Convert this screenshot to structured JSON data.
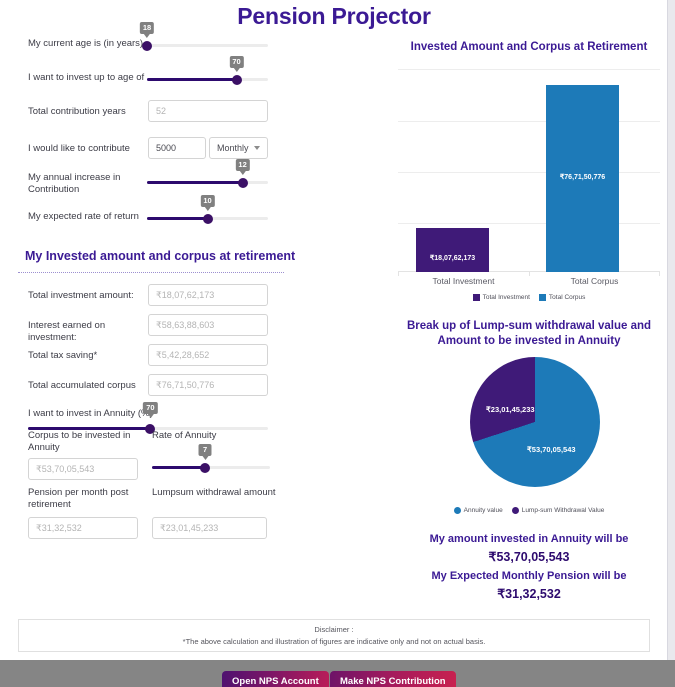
{
  "app": {
    "title": "Pension Projector"
  },
  "inputs": {
    "current_age": {
      "label": "My current age is (in years)",
      "value": "18",
      "min": 18,
      "max": 60,
      "percent": 0
    },
    "invest_upto_age": {
      "label": "I want to invest up to age of",
      "value": "70",
      "min": 18,
      "max": 75,
      "percent": 74
    },
    "total_contribution_years": {
      "label": "Total contribution years",
      "value": "52"
    },
    "contribute": {
      "label": "I would like to contribute",
      "amount": "5000",
      "frequency": "Monthly"
    },
    "annual_increase": {
      "label_line1": "My annual increase in",
      "label_line2": "Contribution",
      "value": "12",
      "percent": 79
    },
    "expected_rate": {
      "label": "My expected rate of return",
      "value": "10",
      "percent": 50
    }
  },
  "results_section": {
    "heading": "My Invested amount and corpus at retirement",
    "fields": [
      {
        "label": "Total investment amount:",
        "value": "₹18,07,62,173"
      },
      {
        "label": "Interest earned on investment:",
        "value": "₹58,63,88,603"
      },
      {
        "label": "Total tax saving*",
        "value": "₹5,42,28,652"
      },
      {
        "label": "Total accumulated corpus",
        "value": "₹76,71,50,776"
      }
    ],
    "annuity_slider": {
      "label": "I want to invest in Annuity (%)",
      "value": "70",
      "percent": 70
    },
    "corpus_annuity": {
      "label": "Corpus to be invested in Annuity",
      "value": "₹53,70,05,543"
    },
    "rate_of_annuity": {
      "label": "Rate of Annuity",
      "value": "7",
      "percent": 45
    },
    "pension_per_month": {
      "label_line1": "Pension per month post",
      "label_line2": "retirement",
      "value": "₹31,32,532"
    },
    "lumpsum_withdrawal": {
      "label": "Lumpsum withdrawal amount",
      "value": "₹23,01,45,233"
    }
  },
  "summary": {
    "annuity_line": "My amount invested in Annuity will be",
    "annuity_value": "₹53,70,05,543",
    "pension_line": "My Expected Monthly Pension will be",
    "pension_value": "₹31,32,532"
  },
  "disclaimer": {
    "heading": "Disclaimer :",
    "text": "*The above calculation and illustration of figures are indicative only and not on actual basis."
  },
  "footer": {
    "open_account": "Open NPS Account",
    "make_contribution": "Make NPS Contribution"
  },
  "colors": {
    "purple": "#3F1A78",
    "blue": "#1D7AB8",
    "heading": "#3b1a94",
    "slider_fill": "#2d0a6e"
  },
  "chart_data": [
    {
      "type": "bar",
      "title": "Invested Amount and Corpus at Retirement",
      "categories": [
        "Total Investment",
        "Total Corpus"
      ],
      "values": [
        180762173,
        767150776
      ],
      "value_labels": [
        "₹18,07,62,173",
        "₹76,71,50,776"
      ],
      "colors": [
        "#3F1A78",
        "#1D7AB8"
      ],
      "legend": [
        "Total Investment",
        "Total Corpus"
      ],
      "legend_position": "bottom",
      "ylim": [
        0,
        840000000
      ],
      "grid": true,
      "xlabel": "",
      "ylabel": ""
    },
    {
      "type": "pie",
      "title": "Break up of Lump-sum withdrawal value and Amount to be invested in Annuity",
      "labels": [
        "Annuity value",
        "Lump-sum Withdrawal Value"
      ],
      "values": [
        537005543,
        230145233
      ],
      "value_labels": [
        "₹53,70,05,543",
        "₹23,01,45,233"
      ],
      "percentages": [
        70,
        30
      ],
      "colors": [
        "#1D7AB8",
        "#3F1A78"
      ],
      "legend": [
        "Annuity value",
        "Lump-sum Withdrawal Value"
      ],
      "legend_position": "bottom"
    }
  ]
}
